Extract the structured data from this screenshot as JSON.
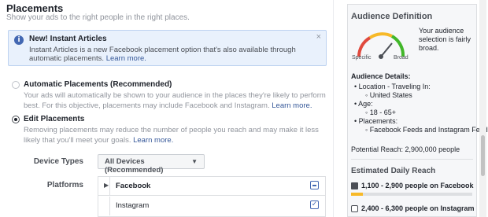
{
  "section": {
    "title": "Placements",
    "subtitle": "Show your ads to the right people in the right places."
  },
  "info_banner": {
    "icon": "info-icon",
    "title": "New! Instant Articles",
    "text": "Instant Articles is a new Facebook placement option that's also available through automatic placements.",
    "link": "Learn more.",
    "close": "×"
  },
  "automatic": {
    "label": "Automatic Placements (Recommended)",
    "desc": "Your ads will automatically be shown to your audience in the places they're likely to perform best. For this objective, placements may include Facebook and Instagram.",
    "link": "Learn more.",
    "selected": false
  },
  "edit": {
    "label": "Edit Placements",
    "desc": "Removing placements may reduce the number of people you reach and may make it less likely that you'll meet your goals.",
    "link": "Learn more.",
    "selected": true
  },
  "device_types": {
    "label": "Device Types",
    "value": "All Devices (Recommended)",
    "caret": "▼"
  },
  "platforms": {
    "label": "Platforms",
    "items": [
      {
        "name": "Facebook",
        "expand": "▶",
        "state": "partial"
      },
      {
        "name": "Instagram",
        "state": "checked",
        "check": "✓"
      }
    ]
  },
  "audience": {
    "title": "Audience Definition",
    "gauge_min": "Specific",
    "gauge_max": "Broad",
    "gauge_level": 0.72,
    "description": "Your audience selection is fairly broad.",
    "details_title": "Audience Details:",
    "details": [
      "Location - Traveling In:",
      "United States",
      "Age:",
      "18 - 65+",
      "Placements:",
      "Facebook Feeds and Instagram Feed"
    ],
    "potential_reach": "Potential Reach: 2,900,000 people"
  },
  "daily_reach": {
    "title": "Estimated Daily Reach",
    "rows": [
      {
        "icon": "facebook-icon",
        "text": "1,100 - 2,900 people on Facebook",
        "fill": 0.1
      },
      {
        "icon": "instagram-icon",
        "text": "2,400 - 6,300 people on Instagram",
        "fill": 0.1
      }
    ]
  },
  "colors": {
    "accent": "#4267b2",
    "link": "#365899",
    "bar_fill": "#f7b928"
  }
}
